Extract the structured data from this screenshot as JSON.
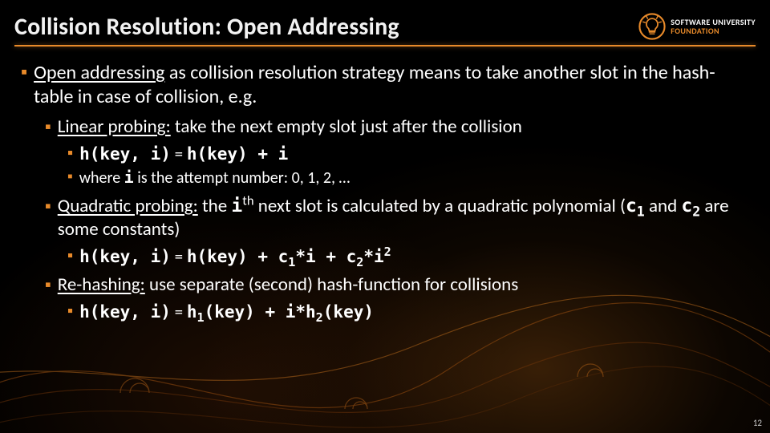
{
  "title": "Collision Resolution: Open Addressing",
  "logo": {
    "line1": "SOFTWARE UNIVERSITY",
    "line2": "FOUNDATION"
  },
  "intro": {
    "lead": "Open addressing",
    "rest": " as collision resolution strategy means to take another slot in the hash-table in case of collision, e.g."
  },
  "linear": {
    "lead": "Linear probing:",
    "rest": " take the next empty slot just after the collision",
    "formula_lhs": "h(key, i)",
    "formula_eq": " = ",
    "formula_rhs_a": "h(key) + ",
    "formula_rhs_i": "i",
    "where_pre": "where ",
    "where_i": "i",
    "where_post": " is the attempt number: 0, 1, 2, …"
  },
  "quadratic": {
    "lead": "Quadratic probing:",
    "rest_a": " the ",
    "rest_i": "i",
    "rest_th": "th",
    "rest_b": " next slot is calculated by a quadratic polynomial (",
    "c1": "c",
    "c1_sub": "1",
    "rest_and": " and ",
    "c2": "c",
    "c2_sub": "2",
    "rest_c": " are some constants)",
    "formula_lhs": "h(key, i)",
    "formula_eq": " = ",
    "f_a": "h(key) + ",
    "f_c1": "c",
    "f_c1_sub": "1",
    "f_mul1": "*i + ",
    "f_c2": "c",
    "f_c2_sub": "2",
    "f_mul2": "*i",
    "f_sq": "2"
  },
  "rehash": {
    "lead": "Re-hashing:",
    "rest": " use separate (second) hash-function for collisions",
    "formula_lhs": "h(key, i)",
    "formula_eq": " = ",
    "f_a": "h",
    "f_1": "1",
    "f_b": "(key) + i*h",
    "f_2": "2",
    "f_c": "(key)"
  },
  "page_number": "12"
}
